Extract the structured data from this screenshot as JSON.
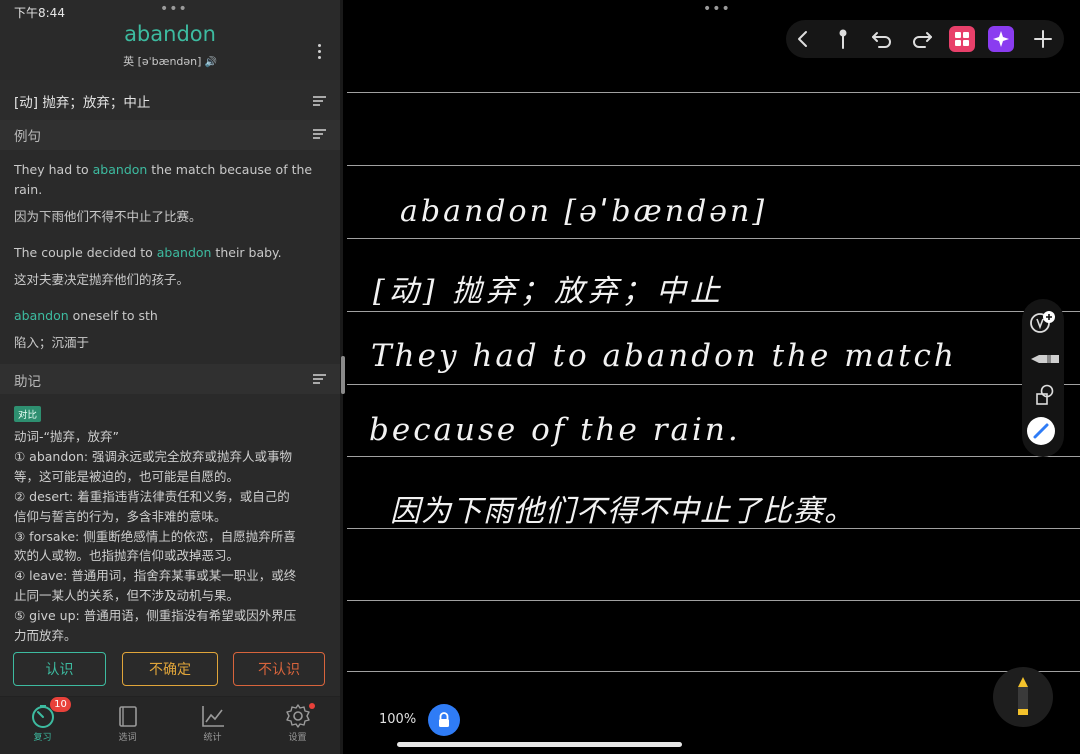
{
  "status": {
    "time": "下午8:44"
  },
  "dict": {
    "word": "abandon",
    "phonetic": "英 [əˈbændən]",
    "definition": "[动] 抛弃；放弃；中止",
    "examples_label": "例句",
    "examples": [
      {
        "en_pre": "They had to ",
        "en_hl": "abandon",
        "en_post": " the match because of the rain.",
        "cn": "因为下雨他们不得不中止了比赛。"
      },
      {
        "en_pre": "The couple decided to ",
        "en_hl": "abandon",
        "en_post": " their baby.",
        "cn": "这对夫妻决定抛弃他们的孩子。"
      },
      {
        "en_pre": "",
        "en_hl": "abandon",
        "en_post": " oneself to sth",
        "cn": "陷入；沉湎于"
      }
    ],
    "mnemonic_label": "助记",
    "mnemonic_tag": "对比",
    "mnemonic_lines": [
      "动词-“抛弃，放弃”",
      "① abandon: 强调永远或完全放弃或抛弃人或事物",
      "等，这可能是被迫的，也可能是自愿的。",
      "② desert: 着重指违背法律责任和义务，或自己的",
      "信仰与誓言的行为，多含非难的意味。",
      "③ forsake: 侧重断绝感情上的依恋，自愿抛弃所喜",
      "欢的人或物。也指抛弃信仰或改掉恶习。",
      "④ leave: 普通用词，指舍弃某事或某一职业，或终",
      "止同一某人的关系，但不涉及动机与果。",
      "⑤ give up: 普通用语，侧重指没有希望或因外界压",
      "力而放弃。"
    ],
    "buttons": {
      "know": "认识",
      "unsure": "不确定",
      "unknown": "不认识"
    },
    "tabs": [
      {
        "label": "复习",
        "icon": "review-timer-icon",
        "badge": "10"
      },
      {
        "label": "选词",
        "icon": "book-icon"
      },
      {
        "label": "统计",
        "icon": "stats-chart-icon"
      },
      {
        "label": "设置",
        "icon": "gear-icon"
      }
    ]
  },
  "notes": {
    "lines": [
      "abandon  [əˈbændən]",
      "[动] 抛弃；放弃；中止",
      "They had to abandon the match",
      "because of the rain.",
      "因为下雨他们不得不中止了比赛。"
    ],
    "zoom": "100%"
  },
  "colors": {
    "accent": "#3dbba0",
    "unsure": "#e0a53a",
    "unknown": "#d8643c",
    "lock": "#2f7cf6"
  }
}
